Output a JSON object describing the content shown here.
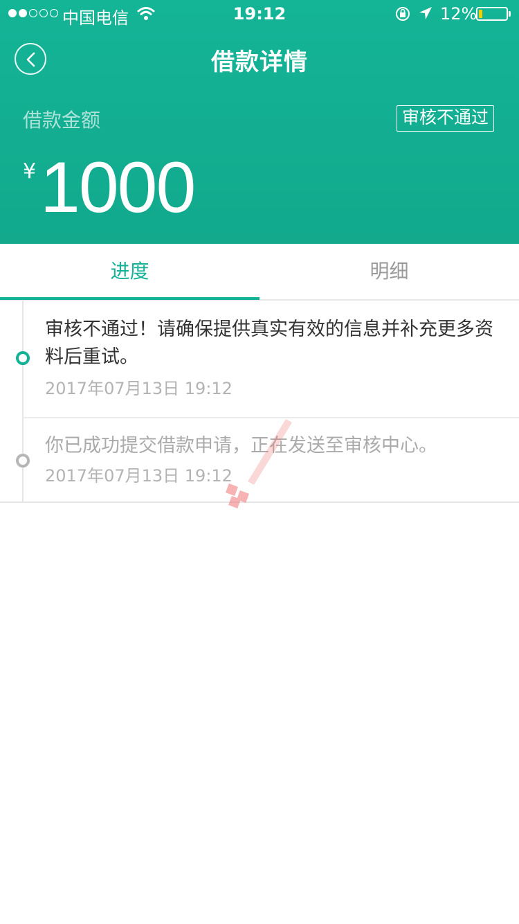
{
  "status_bar": {
    "carrier": "中国电信",
    "time": "19:12",
    "battery": "12%",
    "battery_level": 0.12
  },
  "nav": {
    "title": "借款详情",
    "back_icon": "chevron-left-icon"
  },
  "summary": {
    "amount_label": "借款金额",
    "status_tag": "审核不通过",
    "currency": "¥",
    "amount": "1000"
  },
  "tabs": [
    {
      "label": "进度",
      "active": true
    },
    {
      "label": "明细",
      "active": false
    }
  ],
  "timeline": [
    {
      "text": "审核不通过！请确保提供真实有效的信息并补充更多资料后重试。",
      "time": "2017年07月13日 19:12",
      "color": "#13b196"
    },
    {
      "text": "你已成功提交借款申请，正在发送至审核中心。",
      "time": "2017年07月13日 19:12",
      "color": "#b6b6b6"
    }
  ],
  "colors": {
    "brand": "#13b196",
    "battery": "#f5d000"
  }
}
